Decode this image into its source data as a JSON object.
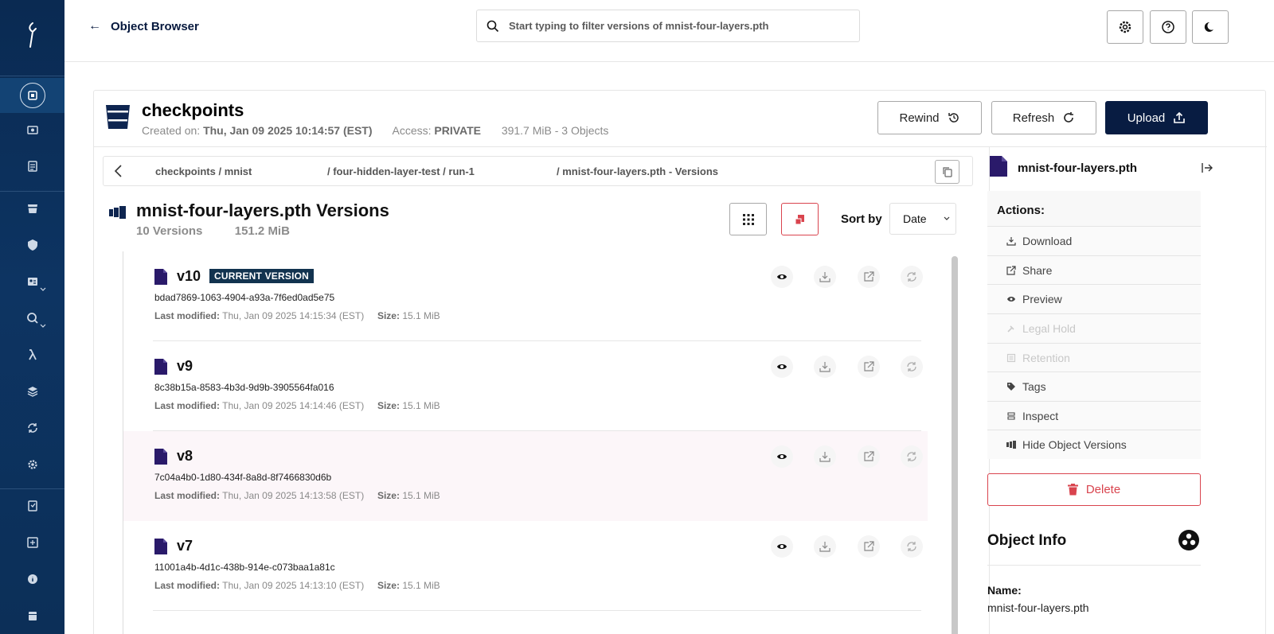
{
  "topbar": {
    "back_label": "Object Browser",
    "search_placeholder": "Start typing to filter versions of mnist-four-layers.pth"
  },
  "bucket": {
    "name": "checkpoints",
    "created_label": "Created on:",
    "created_value": "Thu, Jan 09 2025 10:14:57 (EST)",
    "access_label": "Access:",
    "access_value": "PRIVATE",
    "size_summary": "391.7 MiB - 3 Objects",
    "buttons": {
      "rewind": "Rewind",
      "refresh": "Refresh",
      "upload": "Upload"
    }
  },
  "breadcrumb": {
    "seg1": "checkpoints / mnist",
    "seg2": "/ four-hidden-layer-test / run-1",
    "seg3": "/ mnist-four-layers.pth - Versions"
  },
  "versions_header": {
    "title": "mnist-four-layers.pth Versions",
    "count": "10 Versions",
    "total_size": "151.2 MiB",
    "sort_label": "Sort by",
    "sort_value": "Date"
  },
  "versions": [
    {
      "name": "v10",
      "badge": "CURRENT VERSION",
      "id": "bdad7869-1063-4904-a93a-7f6ed0ad5e75",
      "modified_label": "Last modified:",
      "modified": "Thu, Jan 09 2025 14:15:34 (EST)",
      "size_label": "Size:",
      "size": "15.1 MiB"
    },
    {
      "name": "v9",
      "badge": "",
      "id": "8c38b15a-8583-4b3d-9d9b-3905564fa016",
      "modified_label": "Last modified:",
      "modified": "Thu, Jan 09 2025 14:14:46 (EST)",
      "size_label": "Size:",
      "size": "15.1 MiB"
    },
    {
      "name": "v8",
      "badge": "",
      "id": "7c04a4b0-1d80-434f-8a8d-8f7466830d6b",
      "modified_label": "Last modified:",
      "modified": "Thu, Jan 09 2025 14:13:58 (EST)",
      "size_label": "Size:",
      "size": "15.1 MiB"
    },
    {
      "name": "v7",
      "badge": "",
      "id": "11001a4b-4d1c-438b-914e-c073baa1a81c",
      "modified_label": "Last modified:",
      "modified": "Thu, Jan 09 2025 14:13:10 (EST)",
      "size_label": "Size:",
      "size": "15.1 MiB"
    }
  ],
  "object_panel": {
    "file_name": "mnist-four-layers.pth",
    "actions_title": "Actions:",
    "actions": [
      "Download",
      "Share",
      "Preview",
      "Legal Hold",
      "Retention",
      "Tags",
      "Inspect",
      "Hide Object Versions"
    ],
    "delete_label": "Delete",
    "info_title": "Object Info",
    "name_label": "Name:",
    "name_value": "mnist-four-layers.pth"
  },
  "colors": {
    "sidebar": "#0c2f58",
    "primary": "#081c42",
    "danger": "#d9444e",
    "file_icon": "#2a1a6a"
  }
}
